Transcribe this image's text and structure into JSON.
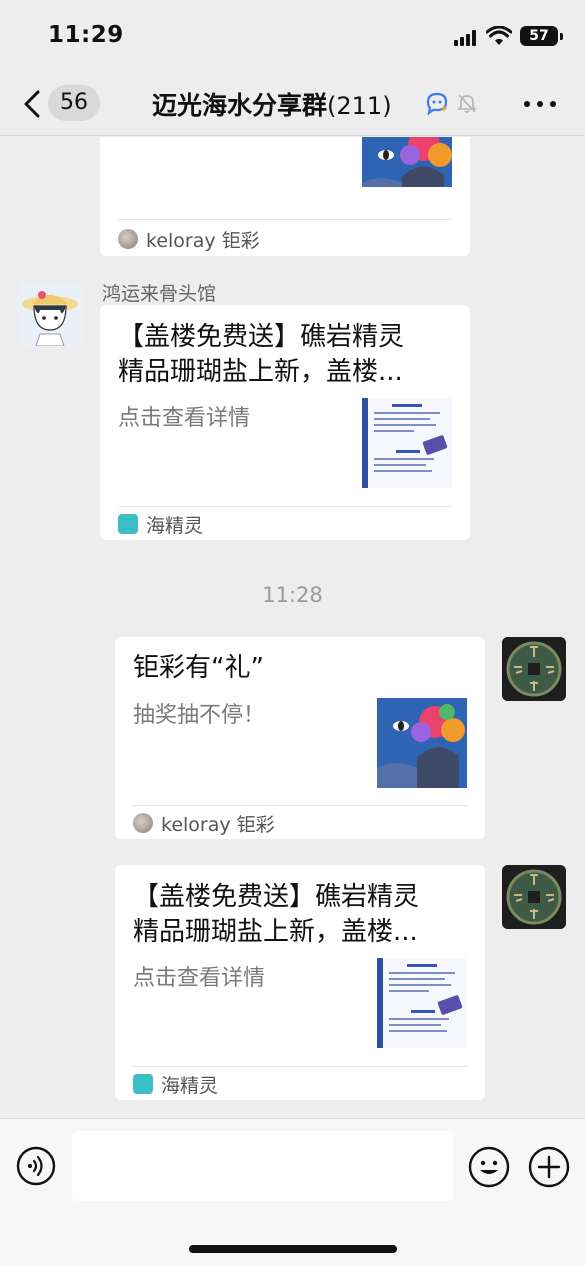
{
  "status_bar": {
    "time": "11:29",
    "battery": "57"
  },
  "nav": {
    "unread_count": "56",
    "group_name": "迈光海水分享群",
    "member_count": "(211)"
  },
  "messages": [
    {
      "source_name": "keloray 钜彩"
    },
    {
      "sender": "鸿运来骨头馆",
      "title_line1": "【盖楼免费送】礁岩精灵",
      "title_line2": "精品珊瑚盐上新，盖楼...",
      "desc": "点击查看详情",
      "source_name": "海精灵"
    },
    {
      "timestamp": "11:28"
    },
    {
      "title_line1": "钜彩有“礼”",
      "desc": "抽奖抽不停！",
      "source_name": "keloray 钜彩"
    },
    {
      "title_line1": "【盖楼免费送】礁岩精灵",
      "title_line2": "精品珊瑚盐上新，盖楼...",
      "desc": "点击查看详情",
      "source_name": "海精灵"
    }
  ],
  "icons": {
    "back": "chevron-left-icon",
    "ai": "ai-assistant-icon",
    "mute": "bell-muted-icon",
    "more": "more-icon",
    "voice": "voice-icon",
    "emoji": "emoji-icon",
    "plus": "plus-icon"
  },
  "colors": {
    "background": "#ededed",
    "card": "#ffffff",
    "accent_blue": "#3a7bf6"
  }
}
